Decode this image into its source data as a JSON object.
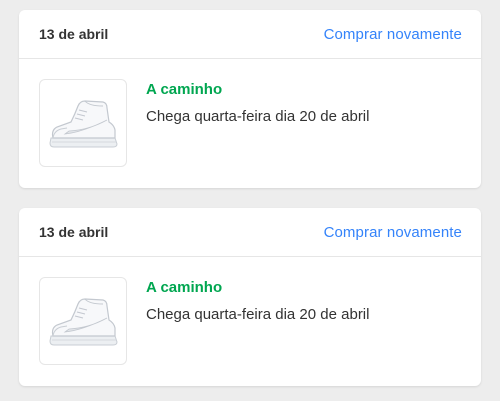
{
  "orders": [
    {
      "date": "13 de abril",
      "buy_again_label": "Comprar novamente",
      "status": "A caminho",
      "eta": "Chega quarta-feira dia 20 de abril",
      "product_icon": "white-sneaker-image"
    },
    {
      "date": "13 de abril",
      "buy_again_label": "Comprar novamente",
      "status": "A caminho",
      "eta": "Chega quarta-feira dia 20 de abril",
      "product_icon": "white-sneaker-image"
    }
  ],
  "colors": {
    "accent": "#3483fa",
    "status": "#00a650",
    "background": "#ededed"
  }
}
